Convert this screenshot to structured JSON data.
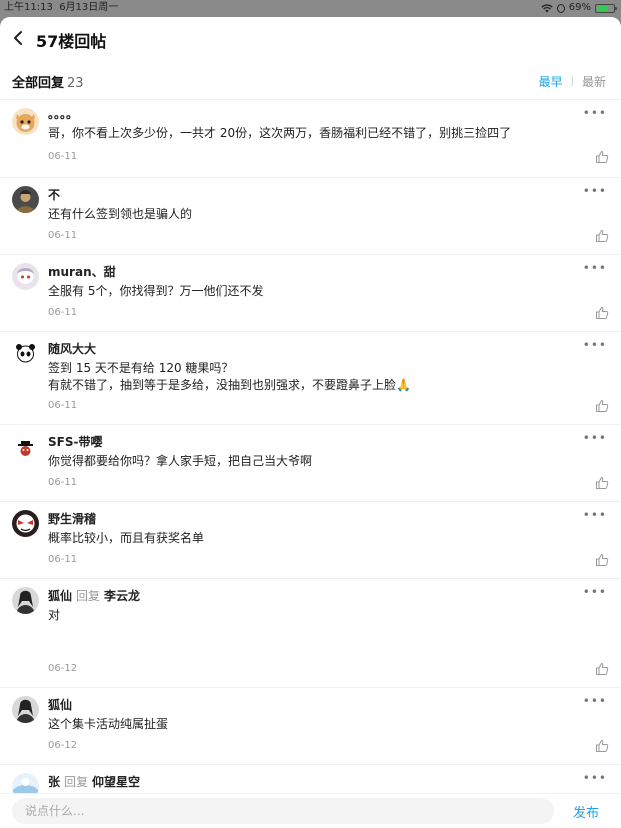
{
  "status": {
    "time": "上午11:13",
    "date": "6月13日周一",
    "battery": "69%",
    "battery_level": 0.69
  },
  "header": {
    "title": "57楼回帖"
  },
  "filter": {
    "label": "全部回复",
    "count": "23",
    "sort_earliest": "最早",
    "sort_latest": "最新"
  },
  "comments": [
    {
      "user": "。。。。",
      "text": "哥，你不看上次多少份，一共才 20份，这次两万，香肠福利已经不错了，别挑三捡四了",
      "date": "06-11"
    },
    {
      "user": "不",
      "text": "还有什么签到领也是骗人的",
      "date": "06-11"
    },
    {
      "user": "muran、甜",
      "text": "全服有 5个，你找得到？万一他们还不发",
      "date": "06-11"
    },
    {
      "user": "随风大大",
      "text_lines": [
        "签到 15 天不是有给 120 糖果吗？",
        "有就不错了，抽到等于是多给，没抽到也别强求，不要蹬鼻子上脸🙏"
      ],
      "date": "06-11"
    },
    {
      "user": "SFS-带嘤",
      "text": "你觉得都要给你吗？拿人家手短，把自己当大爷啊",
      "date": "06-11"
    },
    {
      "user": "野生滑稽",
      "text": "概率比较小，而且有获奖名单",
      "date": "06-11"
    },
    {
      "user": "狐仙",
      "reply_word": "回复",
      "reply_to": "李云龙",
      "text": "对",
      "date": "06-12"
    },
    {
      "user": "狐仙",
      "text": "这个集卡活动纯属扯蛋",
      "date": "06-12"
    },
    {
      "user": "张",
      "reply_word": "回复",
      "reply_to": "仰望星空"
    }
  ],
  "more_label": "•••",
  "input": {
    "placeholder": "说点什么...",
    "submit": "发布"
  },
  "colors": {
    "accent": "#1aa2e6",
    "battery": "#36c759"
  }
}
